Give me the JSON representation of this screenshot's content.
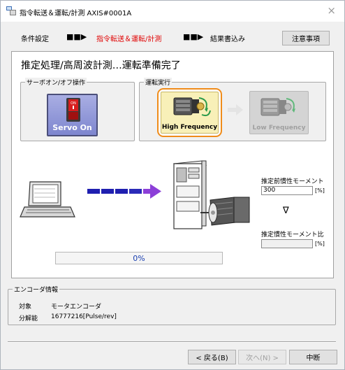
{
  "window": {
    "title": "指令転送＆運転/計測 AXIS#0001A",
    "close_glyph": "×"
  },
  "steps": {
    "items": [
      {
        "label": "条件設定",
        "active": false
      },
      {
        "label": "指令転送＆運転/計測",
        "active": true
      },
      {
        "label": "結果書込み",
        "active": false
      }
    ],
    "arrow_glyph": "■■▶",
    "notes_button": "注意事項"
  },
  "main": {
    "status": "推定処理/高周波計測…運転準備完了",
    "servo_group": {
      "label": "サーボオン/オフ操作",
      "button_label": "Servo On",
      "switch_text": "ON"
    },
    "run_group": {
      "label": "運転実行",
      "high_frequency": "High Frequency",
      "low_frequency": "Low Frequency"
    },
    "inertia": {
      "estimated_label": "推定前慣性モーメント",
      "estimated_value": "300",
      "estimated_unit": "[%]",
      "ratio_label": "推定慣性モーメント比",
      "ratio_value": "",
      "ratio_unit": "[%]",
      "triangle": "∇"
    },
    "progress": {
      "text": "0%",
      "value": 0
    }
  },
  "encoder": {
    "label": "エンコーダ情報",
    "target_label": "対象",
    "target_value": "モータエンコーダ",
    "resolution_label": "分解能",
    "resolution_value": "16777216[Pulse/rev]"
  },
  "footer": {
    "back": "< 戻る(B)",
    "next": "次へ(N) >",
    "cancel": "中断"
  },
  "colors": {
    "active_step": "#e00000",
    "servo_button": "#8e95d8",
    "high_freq_border": "#f08c1a",
    "high_freq_fill": "#f8f0b8",
    "arrow_blue": "#1f1fb0",
    "arrow_purple": "#8c3fd8",
    "progress_text": "#1a3fb0"
  },
  "icons": [
    "app-icon",
    "close-icon",
    "servo-switch-icon",
    "motor-icon",
    "laptop-icon",
    "servo-amplifier-icon",
    "transfer-arrow-icon",
    "triangle-icon"
  ]
}
